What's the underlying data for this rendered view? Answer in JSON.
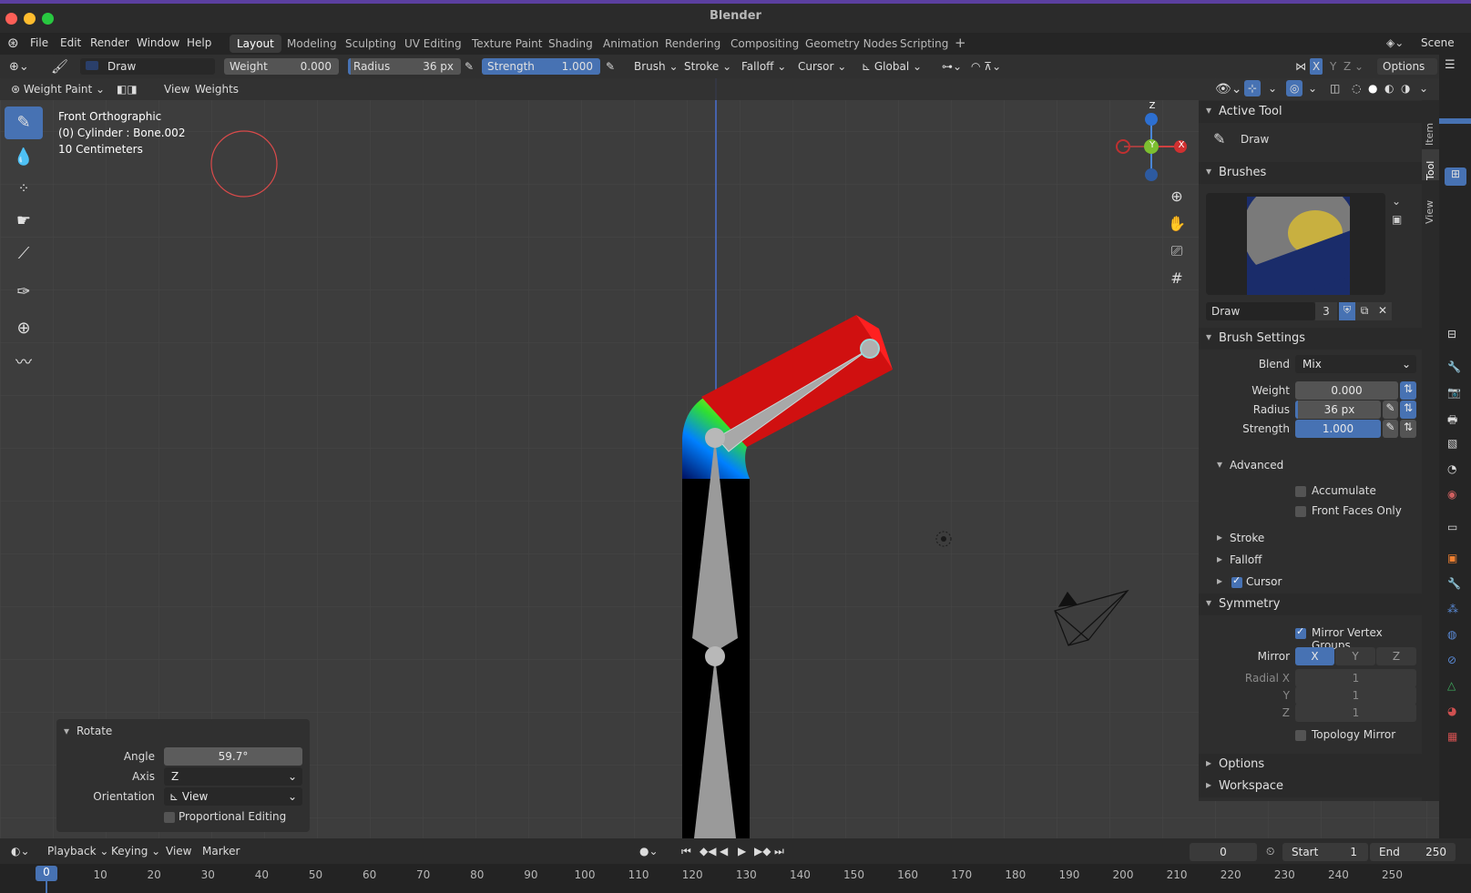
{
  "window_title": "Blender",
  "menu": [
    "File",
    "Edit",
    "Render",
    "Window",
    "Help"
  ],
  "workspace_tabs": [
    "Layout",
    "Modeling",
    "Sculpting",
    "UV Editing",
    "Texture Paint",
    "Shading",
    "Animation",
    "Rendering",
    "Compositing",
    "Geometry Nodes",
    "Scripting"
  ],
  "scene_name": "Scene",
  "tool_header": {
    "brush_name": "Draw",
    "weight_label": "Weight",
    "weight_value": "0.000",
    "radius_label": "Radius",
    "radius_value": "36 px",
    "strength_label": "Strength",
    "strength_value": "1.000",
    "dropdowns": [
      "Brush",
      "Stroke",
      "Falloff",
      "Cursor"
    ],
    "orientation": "Global",
    "options": "Options"
  },
  "viewport_header": {
    "mode": "Weight Paint",
    "view_menu": "View",
    "weights_menu": "Weights"
  },
  "viewport_info": {
    "view_name": "Front Orthographic",
    "object_info": "(0) Cylinder : Bone.002",
    "scale": "10 Centimeters"
  },
  "gizmo": {
    "z": "Z",
    "y": "Y",
    "x": "X"
  },
  "npanel": {
    "active_tool_title": "Active Tool",
    "active_tool_name": "Draw",
    "brushes_title": "Brushes",
    "brush_name": "Draw",
    "brush_users": "3",
    "brush_settings_title": "Brush Settings",
    "blend_label": "Blend",
    "blend_value": "Mix",
    "weight_label": "Weight",
    "weight_value": "0.000",
    "radius_label": "Radius",
    "radius_value": "36 px",
    "strength_label": "Strength",
    "strength_value": "1.000",
    "advanced_title": "Advanced",
    "accumulate": "Accumulate",
    "front_faces_only": "Front Faces Only",
    "stroke": "Stroke",
    "falloff": "Falloff",
    "cursor": "Cursor",
    "symmetry_title": "Symmetry",
    "mirror_vertex_groups": "Mirror Vertex Groups",
    "mirror_label": "Mirror",
    "mirror_axes": [
      "X",
      "Y",
      "Z"
    ],
    "radial_x_label": "Radial X",
    "radial_y_label": "Y",
    "radial_z_label": "Z",
    "radial_x": "1",
    "radial_y": "1",
    "radial_z": "1",
    "topology_mirror": "Topology Mirror",
    "options_title": "Options",
    "workspace_title": "Workspace"
  },
  "vertical_tabs": [
    "Item",
    "Tool",
    "View"
  ],
  "redo_panel": {
    "title": "Rotate",
    "angle_label": "Angle",
    "angle_value": "59.7°",
    "axis_label": "Axis",
    "axis_value": "Z",
    "orientation_label": "Orientation",
    "orientation_value": "View",
    "proportional_editing": "Proportional Editing"
  },
  "timeline": {
    "playback": "Playback",
    "keying": "Keying",
    "view": "View",
    "marker": "Marker",
    "current_frame": "0",
    "start_label": "Start",
    "start_value": "1",
    "end_label": "End",
    "end_value": "250",
    "frame_marker": "0",
    "ticks": [
      "10",
      "20",
      "30",
      "40",
      "50",
      "60",
      "70",
      "80",
      "90",
      "100",
      "110",
      "120",
      "130",
      "140",
      "150",
      "160",
      "170",
      "180",
      "190",
      "200",
      "210",
      "220",
      "230",
      "240",
      "250"
    ]
  },
  "colors": {
    "accent": "#4772b3",
    "brush_circle": "#d94a4a"
  }
}
